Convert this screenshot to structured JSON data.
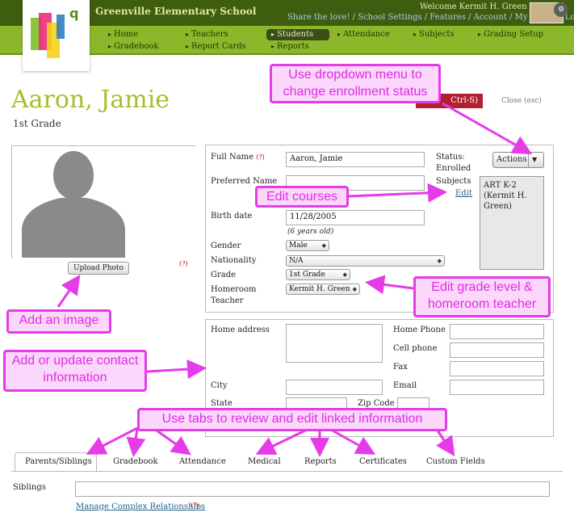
{
  "header": {
    "school_name": "Greenville Elementary School",
    "welcome": "Welcome Kermit H. Green",
    "links": [
      "Share the love!",
      "School Settings",
      "Features",
      "Account",
      "My Profile",
      "Log Off"
    ]
  },
  "nav": {
    "items": [
      "Home",
      "Gradebook",
      "Teachers",
      "Report Cards",
      "Students",
      "Reports",
      "Attendance",
      "Subjects",
      "Grading Setup"
    ],
    "active": "Students"
  },
  "student": {
    "name": "Aaron, Jamie",
    "grade_heading": "1st Grade",
    "save_label": "Ctrl-S)",
    "close_label": "Close (esc)"
  },
  "photo": {
    "upload_label": "Upload Photo",
    "required_mark": "(?)"
  },
  "form": {
    "full_name_label": "Full Name",
    "full_name_value": "Aaron, Jamie",
    "preferred_name_label": "Preferred Name",
    "birth_date_label": "Birth date",
    "birth_date_value": "11/28/2005",
    "age_text": "(6 years old)",
    "gender_label": "Gender",
    "gender_value": "Male",
    "nationality_label": "Nationality",
    "nationality_value": "N/A",
    "grade_label": "Grade",
    "grade_value": "1st Grade",
    "homeroom_label": "Homeroom",
    "teacher_label": "Teacher",
    "homeroom_value": "Kermit H. Green",
    "status_label": "Status:",
    "status_value": "Enrolled",
    "subjects_label": "Subjects",
    "edit_link": "Edit",
    "actions_label": "Actions",
    "subjects_list": "ART K-2 (Kermit H. Green)"
  },
  "contact": {
    "home_address_label": "Home address",
    "city_label": "City",
    "state_label": "State",
    "zip_label": "Zip Code",
    "home_phone_label": "Home Phone",
    "cell_phone_label": "Cell phone",
    "fax_label": "Fax",
    "email_label": "Email"
  },
  "tabs": [
    "Parents/Siblings",
    "Gradebook",
    "Attendance",
    "Medical",
    "Reports",
    "Certificates",
    "Custom Fields"
  ],
  "siblings": {
    "label": "Siblings",
    "manage_link": "Manage Complex Relationships"
  },
  "callouts": {
    "dropdown": "Use dropdown menu to change enrollment status",
    "courses": "Edit courses",
    "image": "Add an image",
    "contact": "Add or update contact information",
    "grade": "Edit grade level & homeroom teacher",
    "tabs": "Use tabs to review and edit linked information"
  },
  "colors": {
    "topbar": "#3f5d0e",
    "navbar": "#8db72a",
    "name": "#a3bf2c",
    "callout_border": "#e53be8",
    "callout_fill": "#fad7fb",
    "save_button": "#b12030"
  }
}
